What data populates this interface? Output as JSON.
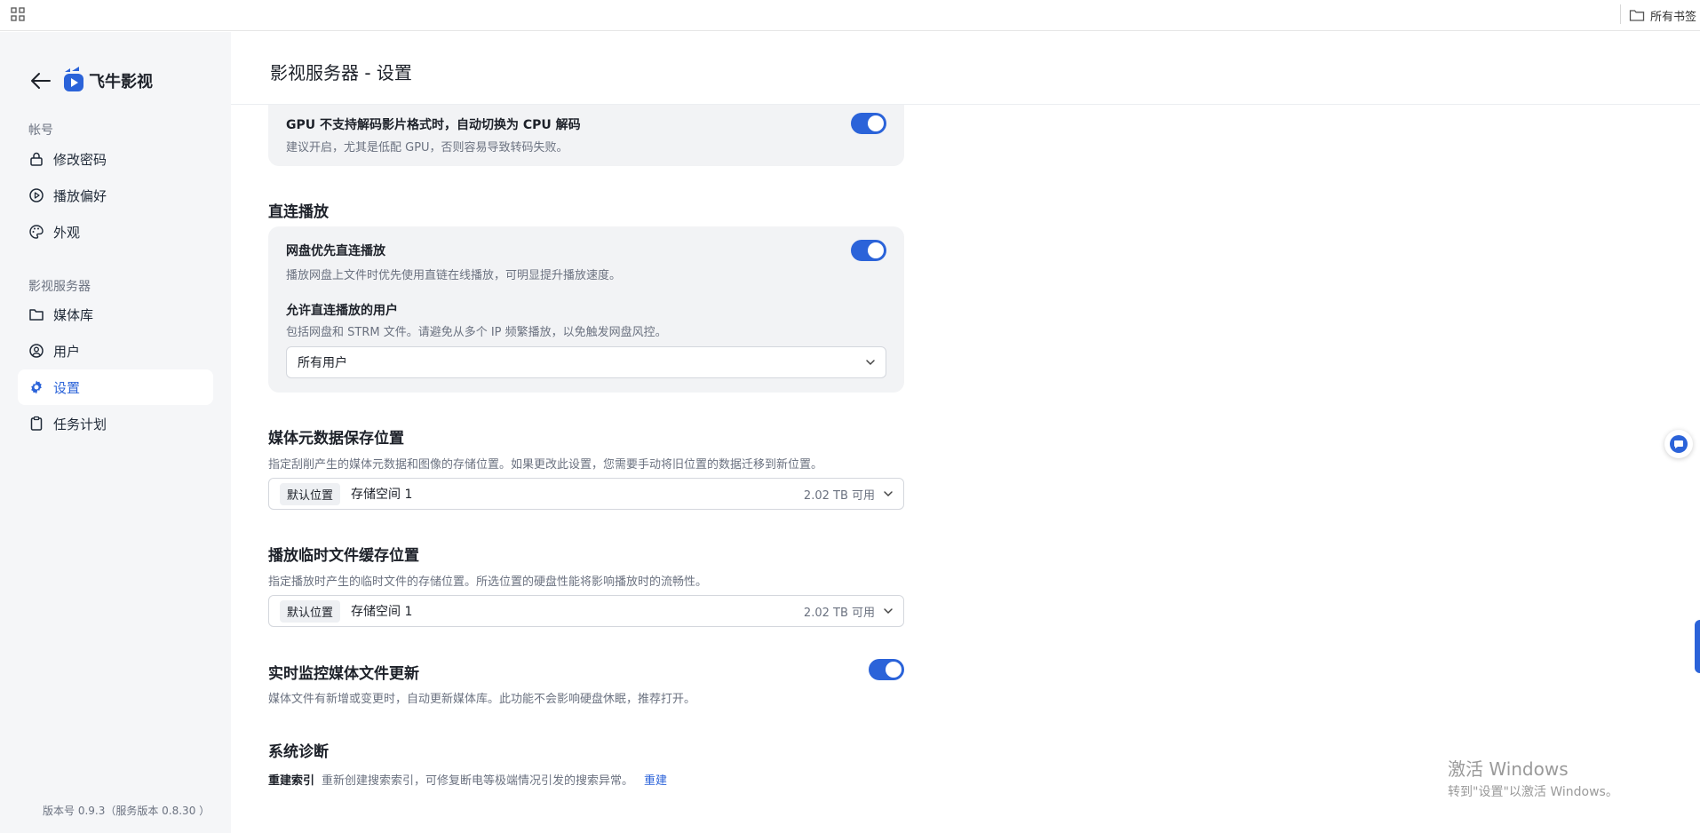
{
  "browser": {
    "bookmark_folder": "所有书签"
  },
  "sidebar": {
    "app_name": "飞牛影视",
    "groups": [
      {
        "label": "帐号"
      },
      {
        "label": "影视服务器"
      }
    ],
    "items": [
      {
        "label": "修改密码",
        "icon": "lock-icon"
      },
      {
        "label": "播放偏好",
        "icon": "play-circle-icon"
      },
      {
        "label": "外观",
        "icon": "palette-icon"
      },
      {
        "label": "媒体库",
        "icon": "folder-icon"
      },
      {
        "label": "用户",
        "icon": "user-icon"
      },
      {
        "label": "设置",
        "icon": "gear-icon",
        "active": true
      },
      {
        "label": "任务计划",
        "icon": "clipboard-icon"
      }
    ],
    "version": "版本号 0.9.3（服务版本 0.8.30 ）"
  },
  "header": {
    "title": "影视服务器 - 设置"
  },
  "settings": {
    "gpu_fallback": {
      "title": "GPU 不支持解码影片格式时，自动切换为 CPU 解码",
      "desc": "建议开启，尤其是低配 GPU，否则容易导致转码失败。",
      "enabled": true
    },
    "direct_play": {
      "section_title": "直连播放",
      "cloud_first_title": "网盘优先直连播放",
      "cloud_first_desc": "播放网盘上文件时优先使用直链在线播放，可明显提升播放速度。",
      "cloud_first_enabled": true,
      "allowed_users_title": "允许直连播放的用户",
      "allowed_users_desc": "包括网盘和 STRM 文件。请避免从多个 IP 频繁播放，以免触发网盘风控。",
      "allowed_users_value": "所有用户"
    },
    "metadata_location": {
      "title": "媒体元数据保存位置",
      "desc": "指定刮削产生的媒体元数据和图像的存储位置。如果更改此设置，您需要手动将旧位置的数据迁移到新位置。",
      "tag": "默认位置",
      "storage": "存储空间 1",
      "free": "2.02 TB 可用"
    },
    "cache_location": {
      "title": "播放临时文件缓存位置",
      "desc": "指定播放时产生的临时文件的存储位置。所选位置的硬盘性能将影响播放时的流畅性。",
      "tag": "默认位置",
      "storage": "存储空间 1",
      "free": "2.02 TB 可用"
    },
    "realtime_monitor": {
      "title": "实时监控媒体文件更新",
      "desc": "媒体文件有新增或变更时，自动更新媒体库。此功能不会影响硬盘休眠，推荐打开。",
      "enabled": true
    },
    "diagnostics": {
      "title": "系统诊断",
      "rebuild_label": "重建索引",
      "rebuild_desc": "重新创建搜索索引，可修复断电等极端情况引发的搜索异常。",
      "rebuild_action": "重建"
    }
  },
  "watermark": {
    "line1": "激活 Windows",
    "line2": "转到\"设置\"以激活 Windows。"
  },
  "colors": {
    "accent": "#2b63d9",
    "sidebar_bg": "#f5f6f8",
    "card_bg": "#f2f3f5"
  }
}
